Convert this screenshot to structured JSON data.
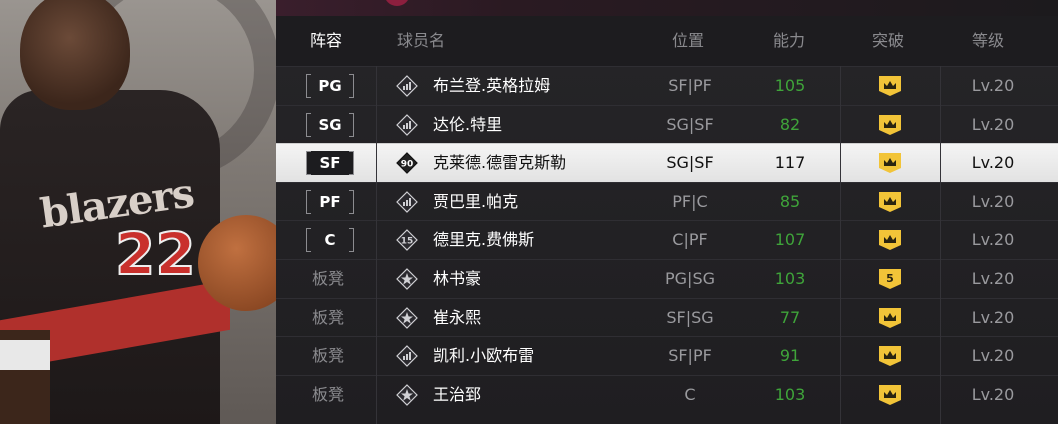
{
  "header": {
    "lineup": "阵容",
    "name": "球员名",
    "position": "位置",
    "rating": "能力",
    "breakthrough": "突破",
    "level": "等级"
  },
  "colors": {
    "rating_green": "#3fa43a",
    "badge_yellow": "#f2c438",
    "accent": "#8c1f3e"
  },
  "roster": [
    {
      "slot": "PG",
      "bench": false,
      "icon": "bars-rank-icon",
      "icon_text": "",
      "name": "布兰登.英格拉姆",
      "pos": "SF|PF",
      "rating": "105",
      "bt": "crown",
      "level": "Lv.20",
      "selected": false
    },
    {
      "slot": "SG",
      "bench": false,
      "icon": "bars-rank-icon",
      "icon_text": "",
      "name": "达伦.特里",
      "pos": "SG|SF",
      "rating": "82",
      "bt": "crown",
      "level": "Lv.20",
      "selected": false
    },
    {
      "slot": "SF",
      "bench": false,
      "icon": "diamond-rank-icon",
      "icon_text": "90",
      "name": "克莱德.德雷克斯勒",
      "pos": "SG|SF",
      "rating": "117",
      "bt": "crown",
      "level": "Lv.20",
      "selected": true
    },
    {
      "slot": "PF",
      "bench": false,
      "icon": "bars-rank-icon",
      "icon_text": "",
      "name": "贾巴里.帕克",
      "pos": "PF|C",
      "rating": "85",
      "bt": "crown",
      "level": "Lv.20",
      "selected": false
    },
    {
      "slot": "C",
      "bench": false,
      "icon": "diamond-rank-icon",
      "icon_text": "15",
      "name": "德里克.费佛斯",
      "pos": "C|PF",
      "rating": "107",
      "bt": "crown",
      "level": "Lv.20",
      "selected": false
    },
    {
      "slot": "板凳",
      "bench": true,
      "icon": "star-rank-icon",
      "icon_text": "",
      "name": "林书豪",
      "pos": "PG|SG",
      "rating": "103",
      "bt": "5",
      "level": "Lv.20",
      "selected": false
    },
    {
      "slot": "板凳",
      "bench": true,
      "icon": "star-rank-icon",
      "icon_text": "",
      "name": "崔永熙",
      "pos": "SF|SG",
      "rating": "77",
      "bt": "crown",
      "level": "Lv.20",
      "selected": false
    },
    {
      "slot": "板凳",
      "bench": true,
      "icon": "bars-rank-icon",
      "icon_text": "",
      "name": "凯利.小欧布雷",
      "pos": "SF|PF",
      "rating": "91",
      "bt": "crown",
      "level": "Lv.20",
      "selected": false
    },
    {
      "slot": "板凳",
      "bench": true,
      "icon": "star-rank-icon",
      "icon_text": "",
      "name": "王治郅",
      "pos": "C",
      "rating": "103",
      "bt": "crown",
      "level": "Lv.20",
      "selected": false
    }
  ]
}
